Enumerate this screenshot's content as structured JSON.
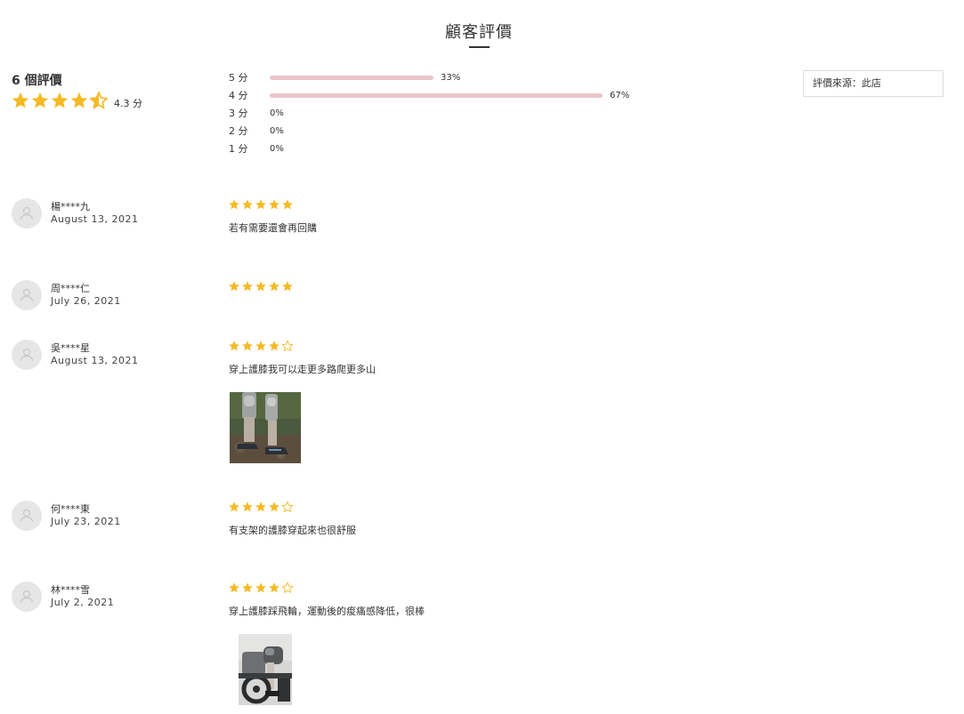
{
  "page_title": "顧客評價",
  "summary": {
    "count_label": "6 個評價",
    "score_label": "4.3 分",
    "rating": 4.3
  },
  "distribution": [
    {
      "label": "5 分",
      "percent": 33,
      "percent_label": "33%"
    },
    {
      "label": "4 分",
      "percent": 67,
      "percent_label": "67%"
    },
    {
      "label": "3 分",
      "percent": 0,
      "percent_label": "0%"
    },
    {
      "label": "2 分",
      "percent": 0,
      "percent_label": "0%"
    },
    {
      "label": "1 分",
      "percent": 0,
      "percent_label": "0%"
    }
  ],
  "source_filter": {
    "label": "評價來源：此店"
  },
  "colors": {
    "star": "#f5b922",
    "bar": "#eac6cb",
    "avatar_bg": "#e6e6e6"
  },
  "reviews": [
    {
      "name": "楊****九",
      "date": "August 13, 2021",
      "stars": 5,
      "text": "若有需要還會再回購",
      "has_photo": false
    },
    {
      "name": "周****仁",
      "date": "July 26, 2021",
      "stars": 5,
      "text": "",
      "has_photo": false
    },
    {
      "name": "吳****星",
      "date": "August 13, 2021",
      "stars": 4,
      "text": "穿上護膝我可以走更多路爬更多山",
      "has_photo": true
    },
    {
      "name": "何****東",
      "date": "July 23, 2021",
      "stars": 4,
      "text": "有支架的護膝穿起來也很舒服",
      "has_photo": false
    },
    {
      "name": "林****雪",
      "date": "July 2, 2021",
      "stars": 4,
      "text": "穿上護膝踩飛輪，運動後的痠痛感降低，很棒",
      "has_photo": true
    }
  ]
}
